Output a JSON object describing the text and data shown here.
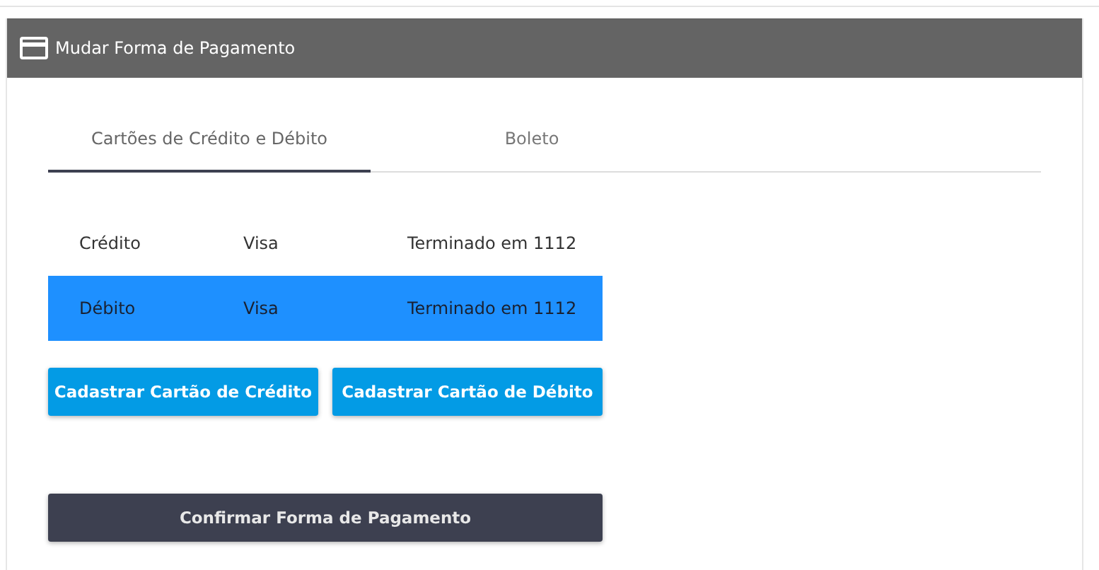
{
  "panel": {
    "title": "Mudar Forma de Pagamento"
  },
  "tabs": [
    {
      "label": "Cartões de Crédito e Débito",
      "selected": true
    },
    {
      "label": "Boleto",
      "selected": false
    }
  ],
  "cards": [
    {
      "type": "Crédito",
      "brand": "Visa",
      "ending": "Terminado em 1112",
      "selected": false
    },
    {
      "type": "Débito",
      "brand": "Visa",
      "ending": "Terminado em 1112",
      "selected": true
    }
  ],
  "add_buttons": [
    "Cadastrar Cartão de Crédito",
    "Cadastrar Cartão de Débito"
  ],
  "confirm_button": "Confirmar Forma de Pagamento"
}
